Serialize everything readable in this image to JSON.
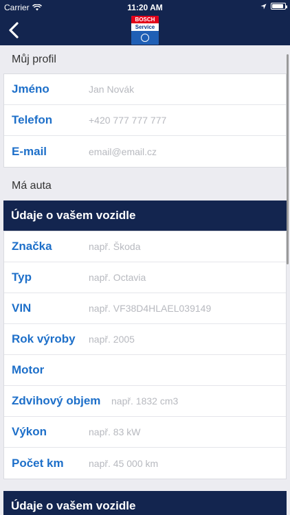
{
  "status_bar": {
    "carrier": "Carrier",
    "time": "11:20 AM",
    "battery_level": 0.9
  },
  "nav": {
    "logo_line1": "BOSCH",
    "logo_line2": "Service",
    "icons": {
      "back": "chevron-left-icon",
      "wifi": "wifi-icon",
      "location": "location-arrow-icon",
      "battery": "battery-icon"
    }
  },
  "profile": {
    "title": "Můj profil",
    "fields": [
      {
        "label": "Jméno",
        "value": "Jan Novák"
      },
      {
        "label": "Telefon",
        "value": "+420 777 777 777"
      },
      {
        "label": "E-mail",
        "value": "email@email.cz"
      }
    ]
  },
  "cars": {
    "title": "Má auta",
    "vehicle_header": "Údaje o vašem vozidle",
    "fields": [
      {
        "label": "Značka",
        "value": "např. Škoda"
      },
      {
        "label": "Typ",
        "value": "např. Octavia"
      },
      {
        "label": "VIN",
        "value": "např. VF38D4HLAEL039149"
      },
      {
        "label": "Rok výroby",
        "value": "např. 2005"
      },
      {
        "label": "Motor",
        "value": ""
      },
      {
        "label": "Zdvihový objem",
        "value": "např. 1832 cm3"
      },
      {
        "label": "Výkon",
        "value": "např. 83 kW"
      },
      {
        "label": "Počet km",
        "value": "např. 45 000 km"
      }
    ],
    "second_vehicle_header": "Údaje o vašem vozidle"
  },
  "colors": {
    "nav_bg": "#13254f",
    "label_blue": "#1d6fc9",
    "placeholder_gray": "#b7b9bf",
    "page_bg": "#ececf1"
  }
}
